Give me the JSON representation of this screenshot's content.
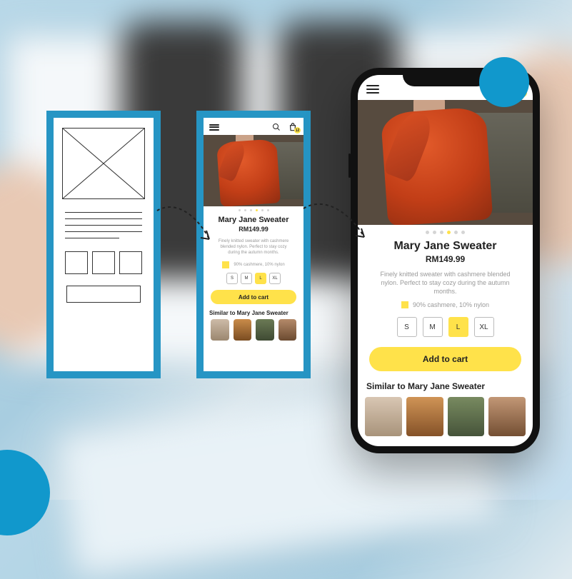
{
  "app": {
    "cart_count": "12",
    "product": {
      "title": "Mary Jane Sweater",
      "price": "RM149.99",
      "description": "Finely knitted sweater with cashmere blended nylon. Perfect to stay cozy during the autumn months.",
      "material": "90% cashmere, 10% nylon",
      "sizes": [
        "S",
        "M",
        "L",
        "XL"
      ],
      "selected_size": "L",
      "cta": "Add to cart",
      "carousel_index": 3,
      "carousel_total": 6
    },
    "similar_heading": "Similar to Mary Jane Sweater"
  },
  "colors": {
    "accent": "#ffe24a",
    "frame": "#2695c4"
  }
}
